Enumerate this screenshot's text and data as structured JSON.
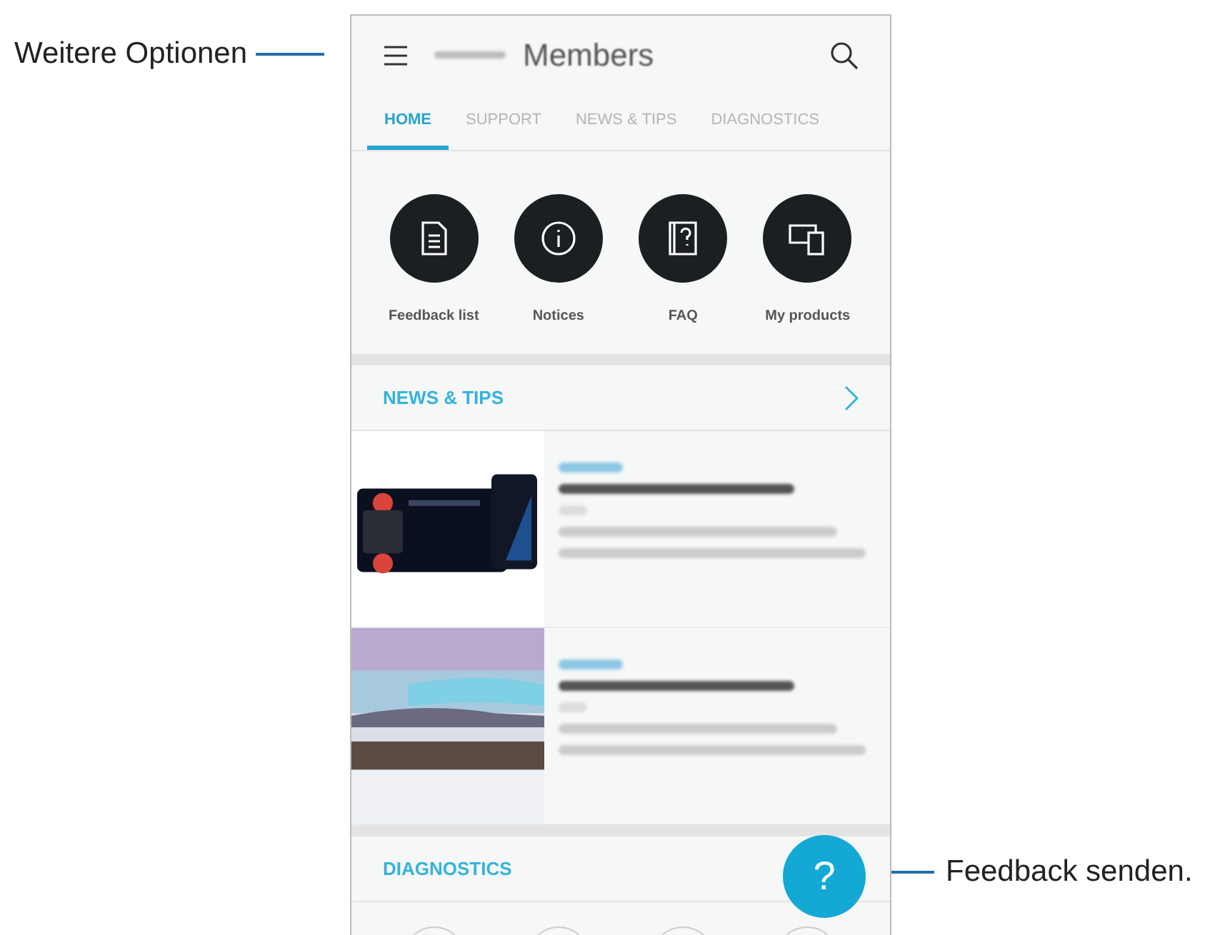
{
  "callouts": [
    {
      "text": "Weitere Optionen"
    },
    {
      "text": "Feedback senden."
    }
  ],
  "app_bar": {
    "title": "Members"
  },
  "tabs": [
    {
      "label": "HOME",
      "selected": true
    },
    {
      "label": "SUPPORT",
      "selected": false
    },
    {
      "label": "NEWS & TIPS",
      "selected": false
    },
    {
      "label": "DIAGNOSTICS",
      "selected": false
    }
  ],
  "shortcuts": [
    {
      "label": "Feedback list",
      "kind": "document"
    },
    {
      "label": "Notices",
      "kind": "info"
    },
    {
      "label": "FAQ",
      "kind": "faq"
    },
    {
      "label": "My products",
      "kind": "devices"
    }
  ],
  "news_section": {
    "title": "NEWS & TIPS"
  },
  "diagnostics_section": {
    "title": "DIAGNOSTICS"
  },
  "fab": {
    "label": "?"
  }
}
